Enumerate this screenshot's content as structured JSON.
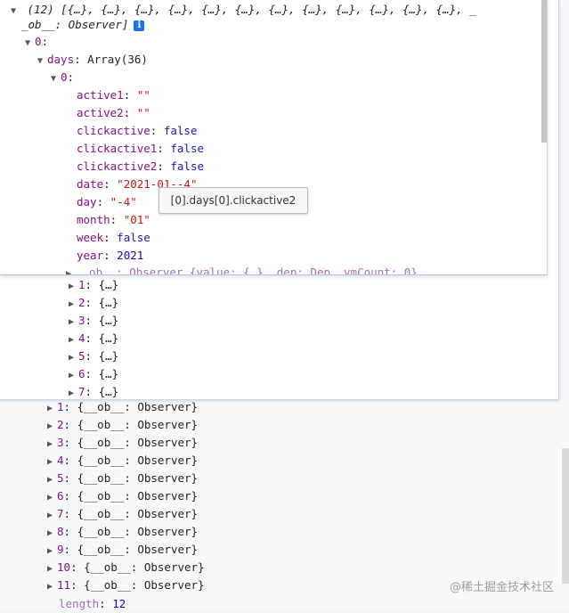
{
  "array_summary": {
    "count": "(12)",
    "preview": "[{…}, {…}, {…}, {…}, {…}, {…}, {…}, {…}, {…}, {…}, {…}, {…}, _",
    "preview2": "_ob__: Observer]",
    "info_icon": "i"
  },
  "item0": {
    "index": "0",
    "days_key": "days",
    "days_value": "Array(36)"
  },
  "day0": {
    "index": "0",
    "props": [
      {
        "k": "active1",
        "v": "\"\"",
        "t": "str"
      },
      {
        "k": "active2",
        "v": "\"\"",
        "t": "str"
      },
      {
        "k": "clickactive",
        "v": "false",
        "t": "kw"
      },
      {
        "k": "clickactive1",
        "v": "false",
        "t": "kw"
      },
      {
        "k": "clickactive2",
        "v": "false",
        "t": "kw"
      },
      {
        "k": "date",
        "v": "\"2021-01--4\"",
        "t": "str"
      },
      {
        "k": "day",
        "v": "\"-4\"",
        "t": "str"
      },
      {
        "k": "month",
        "v": "\"01\"",
        "t": "str"
      },
      {
        "k": "week",
        "v": "false",
        "t": "kw"
      },
      {
        "k": "year",
        "v": "2021",
        "t": "num"
      }
    ],
    "ob_line": "__ob__: Observer {value: {…}, dep: Dep, vmCount: 0}"
  },
  "days_collapsed": [
    {
      "k": "1",
      "v": "{…}"
    },
    {
      "k": "2",
      "v": "{…}"
    },
    {
      "k": "3",
      "v": "{…}"
    },
    {
      "k": "4",
      "v": "{…}"
    },
    {
      "k": "5",
      "v": "{…}"
    },
    {
      "k": "6",
      "v": "{…}"
    },
    {
      "k": "7",
      "v": "{…}"
    }
  ],
  "outer_items": [
    {
      "k": "1",
      "v": "{__ob__: Observer}"
    },
    {
      "k": "2",
      "v": "{__ob__: Observer}"
    },
    {
      "k": "3",
      "v": "{__ob__: Observer}"
    },
    {
      "k": "4",
      "v": "{__ob__: Observer}"
    },
    {
      "k": "5",
      "v": "{__ob__: Observer}"
    },
    {
      "k": "6",
      "v": "{__ob__: Observer}"
    },
    {
      "k": "7",
      "v": "{__ob__: Observer}"
    },
    {
      "k": "8",
      "v": "{__ob__: Observer}"
    },
    {
      "k": "9",
      "v": "{__ob__: Observer}"
    },
    {
      "k": "10",
      "v": "{__ob__: Observer}"
    },
    {
      "k": "11",
      "v": "{__ob__: Observer}"
    }
  ],
  "length": {
    "k": "length",
    "v": "12"
  },
  "tooltip": "[0].days[0].clickactive2",
  "watermark": "@稀土掘金技术社区",
  "colors": {
    "key": "#881280",
    "string": "#c41a16",
    "keyword": "#1a1aa6",
    "number": "#1c00cf",
    "accent": "#1a73e8"
  }
}
